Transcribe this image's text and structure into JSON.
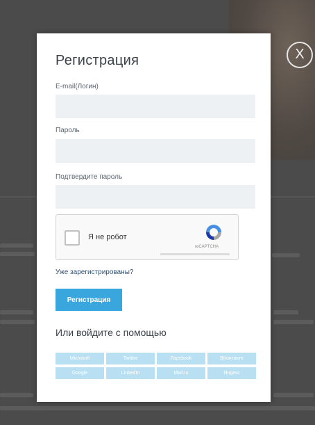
{
  "modal": {
    "title": "Регистрация",
    "email_label": "E-mail(Логин)",
    "email_value": "",
    "password_label": "Пароль",
    "password_value": "",
    "confirm_label": "Подтвердите пароль",
    "confirm_value": "",
    "captcha_label": "Я не робот",
    "captcha_brand": "reCAPTCHA",
    "login_link": "Уже зарегистрированы?",
    "register_button": "Регистрация",
    "social_title": "Или войдите с помощью",
    "social_buttons": [
      "Microsoft",
      "Twitter",
      "Facebook",
      "ВКонтакте",
      "Google",
      "LinkedIn",
      "Mail.ru",
      "Яндекс"
    ],
    "close_icon": "close-icon"
  },
  "colors": {
    "overlay": "#4b4b4b",
    "accent": "#3aa6de",
    "social": "#b9e0f2",
    "input_bg": "#eef1f4"
  }
}
